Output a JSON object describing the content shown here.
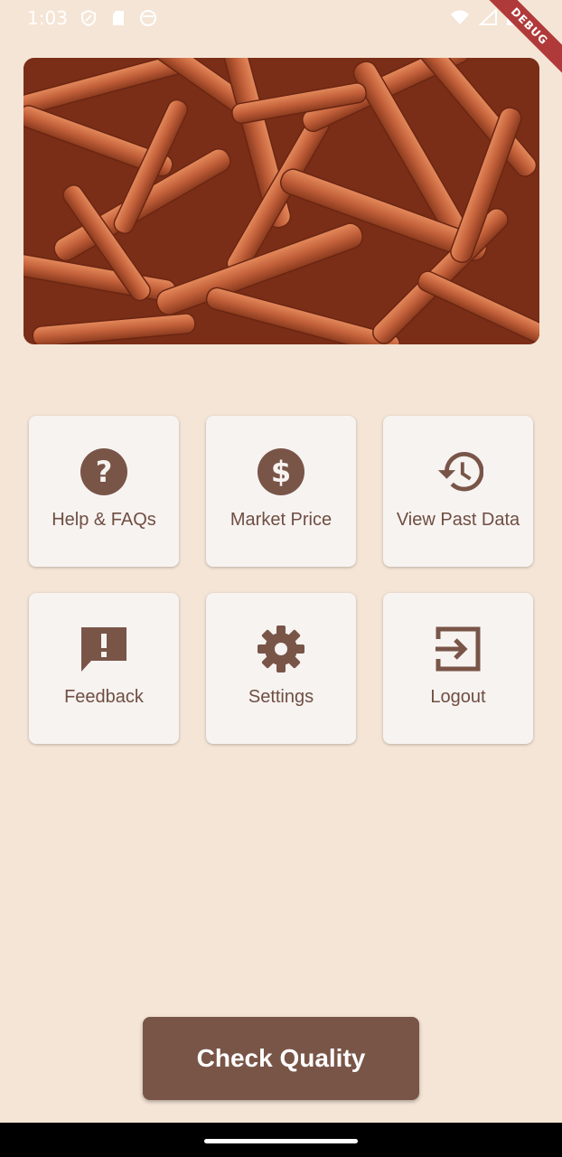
{
  "status_bar": {
    "time": "1:03",
    "left_icons": [
      "shield-icon",
      "sd-card-icon",
      "circle-icon"
    ],
    "right_icons": [
      "wifi-icon",
      "signal-icon",
      "battery-icon"
    ],
    "debug_label": "DEBUG"
  },
  "hero": {
    "subject": "cinnamon-sticks-image"
  },
  "tiles": [
    {
      "label": "Help & FAQs",
      "icon": "help-icon"
    },
    {
      "label": "Market Price",
      "icon": "dollar-icon"
    },
    {
      "label": "View Past Data",
      "icon": "history-icon"
    },
    {
      "label": "Feedback",
      "icon": "feedback-icon"
    },
    {
      "label": "Settings",
      "icon": "gear-icon"
    },
    {
      "label": "Logout",
      "icon": "logout-icon"
    }
  ],
  "primary_action": {
    "label": "Check Quality"
  },
  "colors": {
    "background": "#F5E5D6",
    "accent": "#795548",
    "tile": "#F7F3F1"
  }
}
